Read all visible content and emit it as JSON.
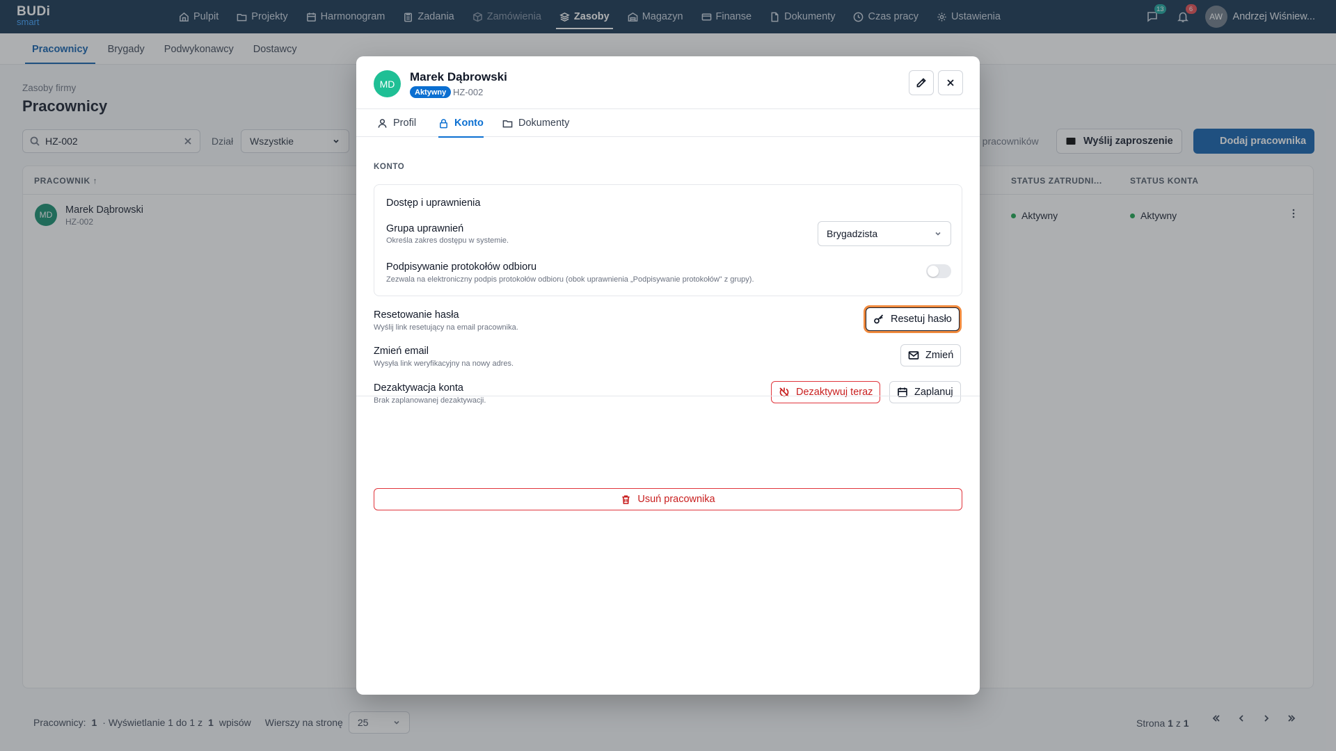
{
  "brand": {
    "line1": "BUDi",
    "line2": "smart"
  },
  "nav": [
    {
      "label": "Pulpit",
      "icon": "home-icon"
    },
    {
      "label": "Projekty",
      "icon": "folder-icon"
    },
    {
      "label": "Harmonogram",
      "icon": "calendar-icon"
    },
    {
      "label": "Zadania",
      "icon": "clipboard-icon"
    },
    {
      "label": "Zamówienia",
      "icon": "box-icon"
    },
    {
      "label": "Zasoby",
      "icon": "layers-icon"
    },
    {
      "label": "Magazyn",
      "icon": "warehouse-icon"
    },
    {
      "label": "Finanse",
      "icon": "card-icon"
    },
    {
      "label": "Dokumenty",
      "icon": "document-icon"
    },
    {
      "label": "Czas pracy",
      "icon": "clock-icon"
    },
    {
      "label": "Ustawienia",
      "icon": "gear-icon"
    }
  ],
  "header_right": {
    "messages_count": "13",
    "notifications_count": "6",
    "user_initials": "AW",
    "user_name": "Andrzej Wiśniew..."
  },
  "subtabs": [
    "Pracownicy",
    "Brygady",
    "Podwykonawcy",
    "Dostawcy"
  ],
  "page": {
    "breadcrumb": "Zasoby firmy",
    "title": "Pracownicy",
    "search_value": "HZ-002",
    "filter_label": "Dział",
    "filter_value": "Wszystkie",
    "count_label": "1 pracowników",
    "invite_label": "Wyślij zaproszenie",
    "add_label": "Dodaj pracownika"
  },
  "table": {
    "columns": {
      "employee": "PRACOWNIK ↑",
      "employment_status": "STATUS ZATRUDNI...",
      "account_status": "STATUS KONTA"
    },
    "rows": [
      {
        "initials": "MD",
        "name": "Marek Dąbrowski",
        "id": "HZ-002",
        "employment_status": "Aktywny",
        "account_status": "Aktywny"
      }
    ]
  },
  "footer": {
    "count_prefix": "Pracownicy:",
    "count": "1",
    "showing_prefix": "· Wyświetlanie 1 do 1 z",
    "showing_total": "1",
    "showing_suffix": "wpisów",
    "rows_label": "Wierszy na stronę",
    "rows_value": "25",
    "page_prefix": "Strona",
    "page_current": "1",
    "page_of": "z",
    "page_total": "1"
  },
  "modal": {
    "initials": "MD",
    "name": "Marek Dąbrowski",
    "status_badge": "Aktywny",
    "employee_id": "HZ-002",
    "tabs": [
      {
        "label": "Profil",
        "icon": "user-icon"
      },
      {
        "label": "Konto",
        "icon": "lock-icon"
      },
      {
        "label": "Dokumenty",
        "icon": "folder-icon"
      }
    ],
    "active_tab": "Konto",
    "section_title": "KONTO",
    "access": {
      "title": "Dostęp i uprawnienia",
      "group_label": "Grupa uprawnień",
      "group_desc": "Określa zakres dostępu w systemie.",
      "group_value": "Brygadzista",
      "signing_label": "Podpisywanie protokołów odbioru",
      "signing_desc": "Zezwala na elektroniczny podpis protokołów odbioru (obok uprawnienia „Podpisywanie protokołów\" z grupy).",
      "signing_enabled": false
    },
    "reset": {
      "label": "Resetowanie hasła",
      "desc": "Wyślij link resetujący na email pracownika.",
      "button": "Resetuj hasło"
    },
    "email": {
      "label": "Zmień email",
      "desc": "Wysyła link weryfikacyjny na nowy adres.",
      "button": "Zmień"
    },
    "deactivate": {
      "label": "Dezaktywacja konta",
      "desc": "Brak zaplanowanej dezaktywacji.",
      "now_button": "Dezaktywuj teraz",
      "schedule_button": "Zaplanuj"
    },
    "delete_button": "Usuń pracownika"
  }
}
